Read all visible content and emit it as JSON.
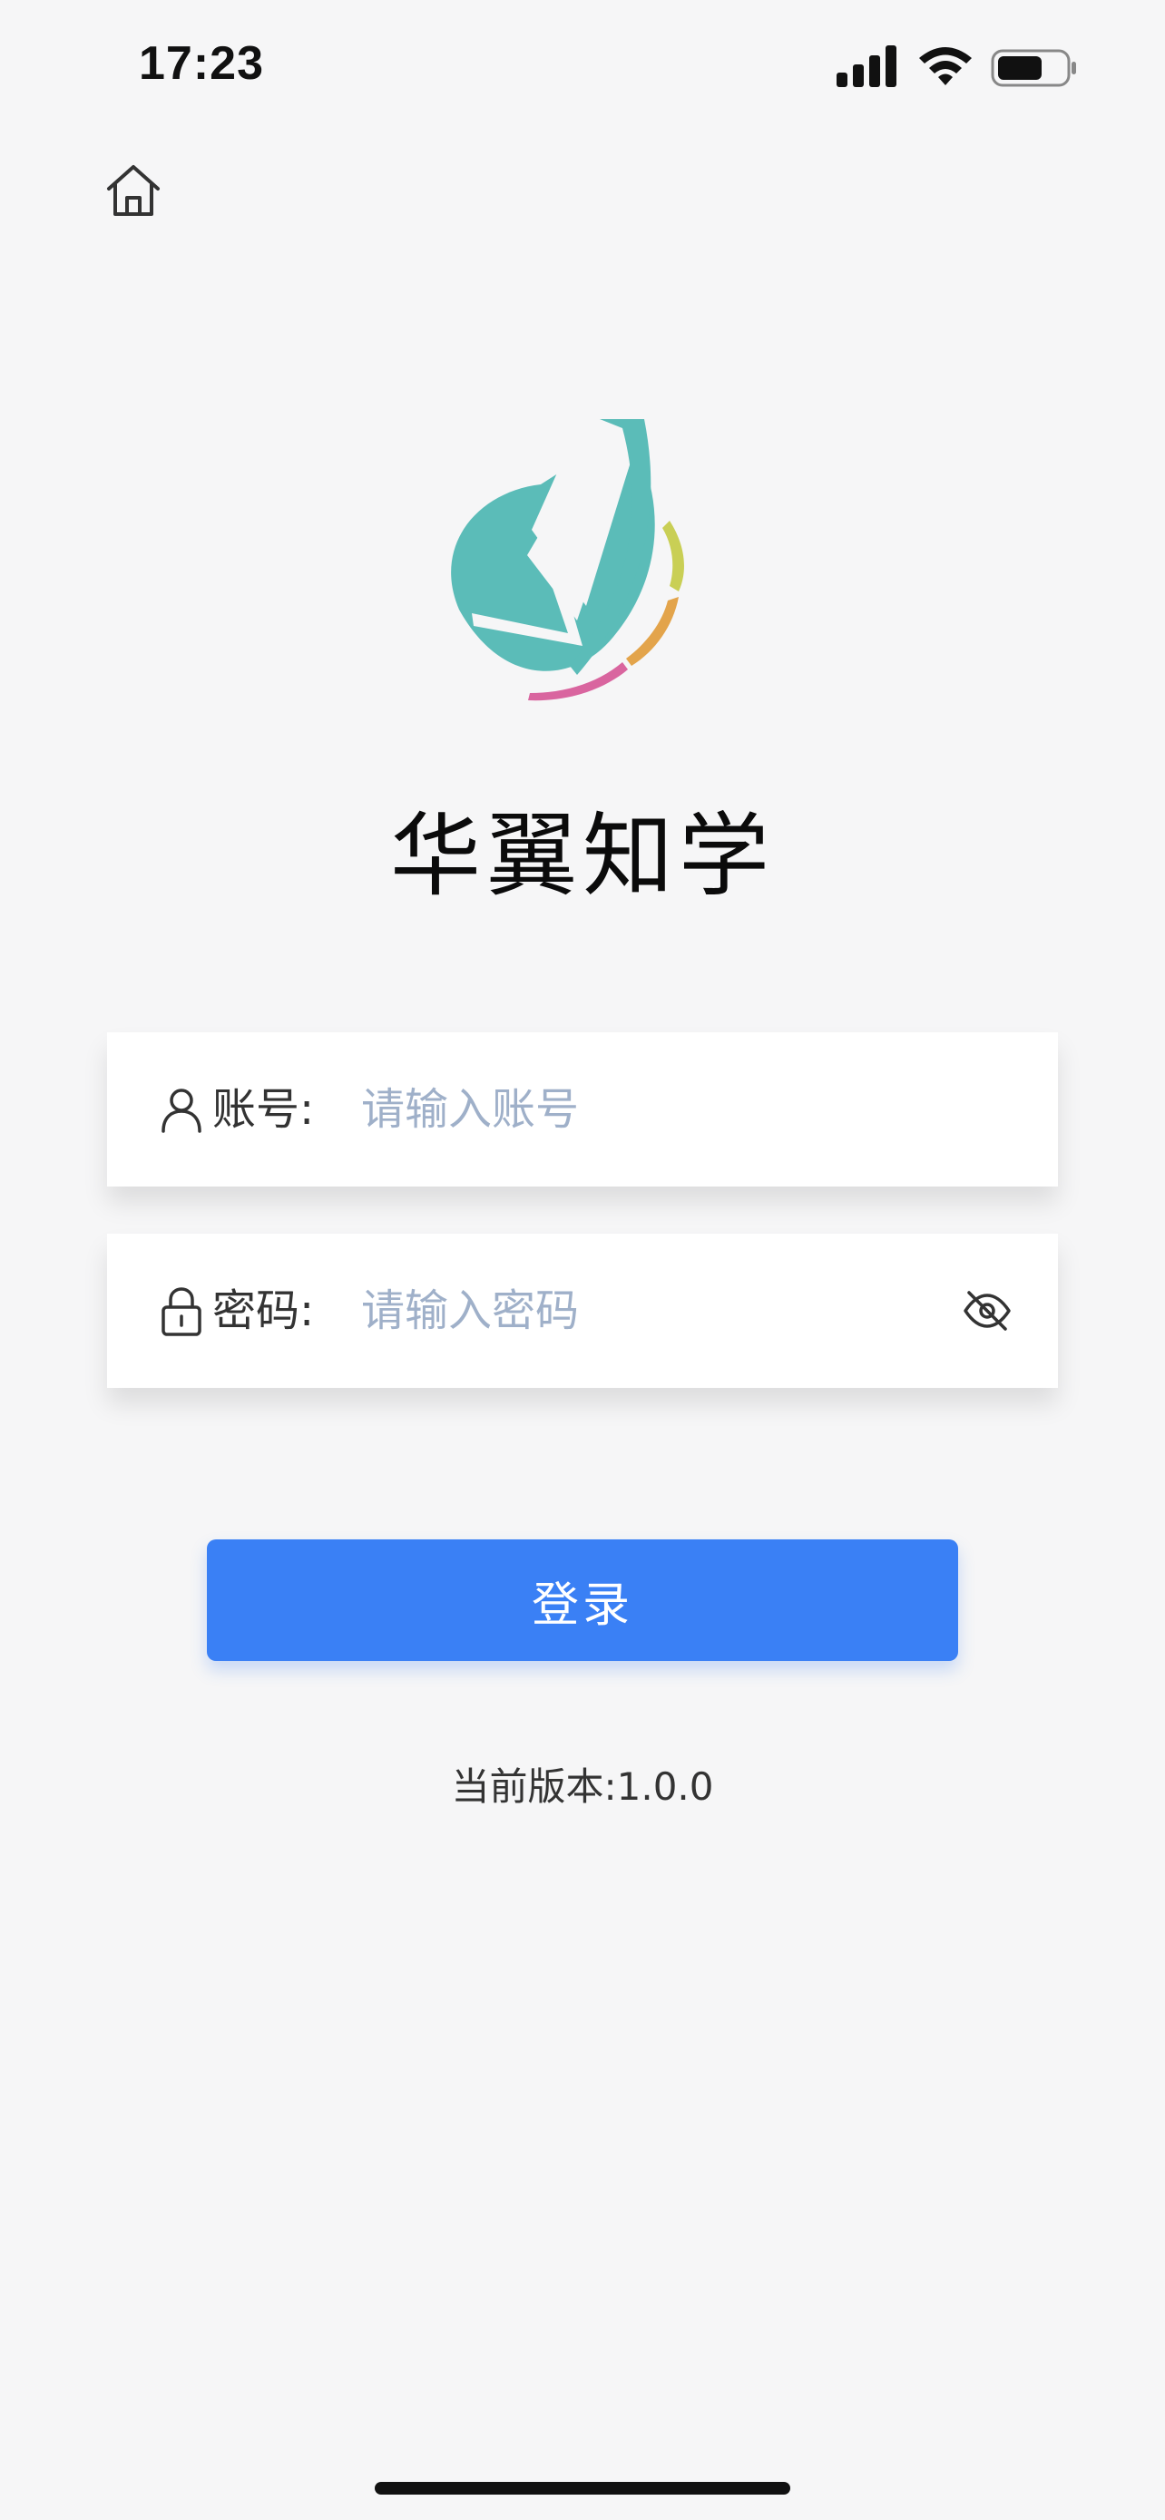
{
  "status_bar": {
    "time": "17:23"
  },
  "app": {
    "title": "华翼知学",
    "logo_colors": [
      "#5bbcb8",
      "#c9cf55",
      "#e3a44b",
      "#d9659f"
    ]
  },
  "form": {
    "account": {
      "label": "账号:",
      "placeholder": "请输入账号",
      "value": ""
    },
    "password": {
      "label": "密码:",
      "placeholder": "请输入密码",
      "value": ""
    }
  },
  "login_button": {
    "label": "登录",
    "color": "#3a80f5"
  },
  "version_text": "当前版本:1.0.0",
  "icons": {
    "home": "home-icon",
    "user": "user-icon",
    "lock": "lock-icon",
    "eye_off": "eye-off-icon"
  }
}
